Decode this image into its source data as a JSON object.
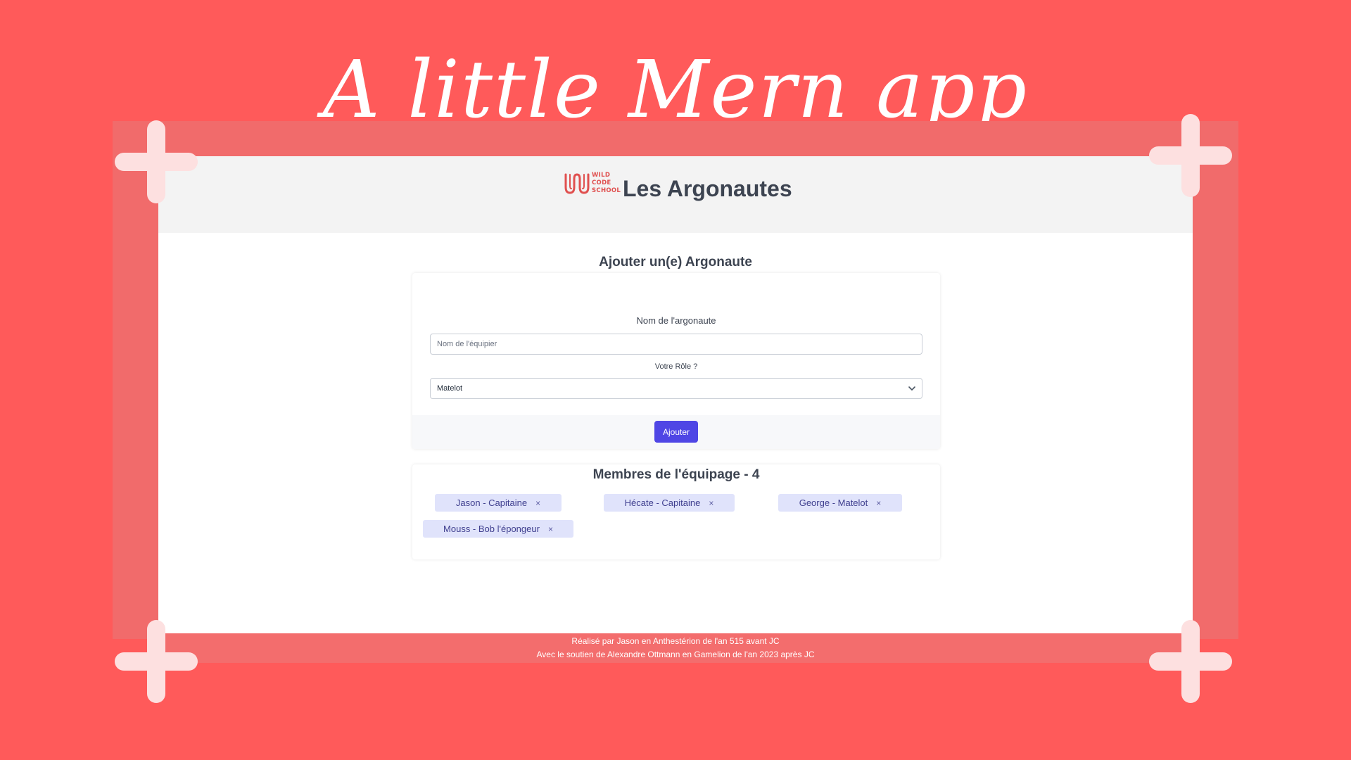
{
  "promo": {
    "title": "A little Mern app"
  },
  "app": {
    "logo": {
      "lines": [
        "WILD",
        "CODE",
        "SCHOOL"
      ],
      "color": "#e0504f"
    },
    "title": "Les Argonautes"
  },
  "form": {
    "heading": "Ajouter un(e) Argonaute",
    "name_label": "Nom de l'argonaute",
    "name_placeholder": "Nom de l'équipier",
    "name_value": "",
    "role_label": "Votre Rôle ?",
    "role_selected": "Matelot",
    "submit_label": "Ajouter"
  },
  "crew": {
    "heading": "Membres de l'équipage - 4",
    "members": [
      {
        "label": "Jason - Capitaine",
        "remove": "×"
      },
      {
        "label": "Hécate - Capitaine",
        "remove": "×"
      },
      {
        "label": "George - Matelot",
        "remove": "×"
      },
      {
        "label": "Mouss - Bob l'épongeur",
        "remove": "×"
      }
    ]
  },
  "footer": {
    "line1": "Réalisé par Jason en Anthestérion de l'an 515 avant JC",
    "line2": "Avec le soutien de Alexandre Ottmann en Gamelion de l'an 2023 après JC"
  },
  "colors": {
    "background": "#ff5a5a",
    "accent_button": "#4f46e5",
    "chip_bg": "#e0e3fb",
    "footer_bg": "#f36d6d",
    "cross": "#fde0e0"
  }
}
